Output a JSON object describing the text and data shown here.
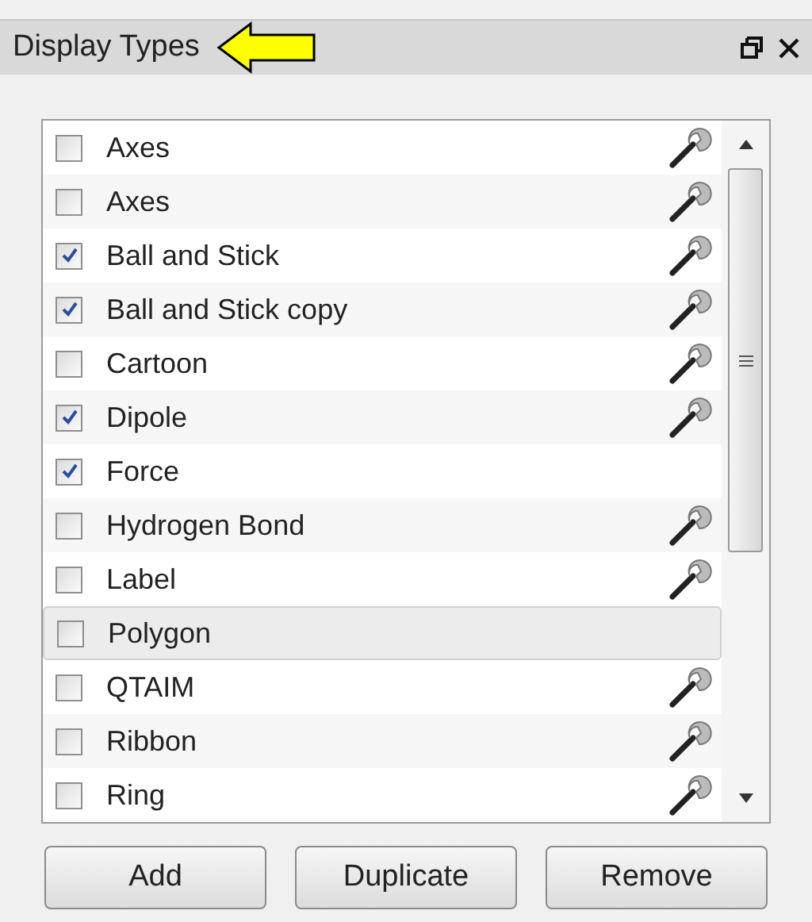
{
  "panel": {
    "title": "Display Types"
  },
  "items": [
    {
      "label": "Axes",
      "checked": false,
      "selected": false,
      "settings": true
    },
    {
      "label": "Axes",
      "checked": false,
      "selected": false,
      "settings": true
    },
    {
      "label": "Ball and Stick",
      "checked": true,
      "selected": false,
      "settings": true
    },
    {
      "label": "Ball and Stick copy",
      "checked": true,
      "selected": false,
      "settings": true
    },
    {
      "label": "Cartoon",
      "checked": false,
      "selected": false,
      "settings": true
    },
    {
      "label": "Dipole",
      "checked": true,
      "selected": false,
      "settings": true
    },
    {
      "label": "Force",
      "checked": true,
      "selected": false,
      "settings": false
    },
    {
      "label": "Hydrogen Bond",
      "checked": false,
      "selected": false,
      "settings": true
    },
    {
      "label": "Label",
      "checked": false,
      "selected": false,
      "settings": true
    },
    {
      "label": "Polygon",
      "checked": false,
      "selected": true,
      "settings": false
    },
    {
      "label": "QTAIM",
      "checked": false,
      "selected": false,
      "settings": true
    },
    {
      "label": "Ribbon",
      "checked": false,
      "selected": false,
      "settings": true
    },
    {
      "label": "Ring",
      "checked": false,
      "selected": false,
      "settings": true
    }
  ],
  "buttons": [
    "Add",
    "Duplicate",
    "Remove"
  ]
}
